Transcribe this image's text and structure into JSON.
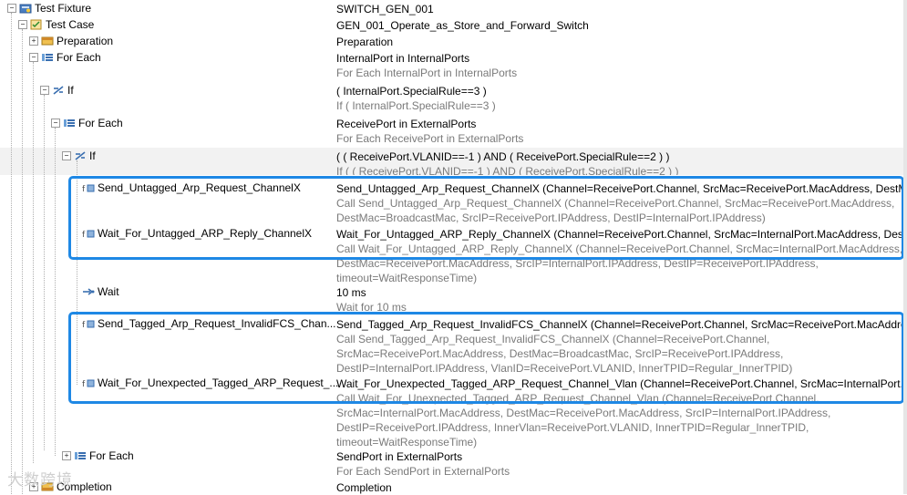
{
  "rows": [
    {
      "label": "Test Fixture",
      "icon": "test-fixture-icon",
      "expander": "−",
      "v1": "SWITCH_GEN_001",
      "v2": []
    },
    {
      "label": "Test Case",
      "icon": "test-case-icon",
      "expander": "−",
      "v1": "GEN_001_Operate_as_Store_and_Forward_Switch",
      "v2": []
    },
    {
      "label": "Preparation",
      "icon": "preparation-icon",
      "expander": "+",
      "v1": "Preparation",
      "v2": []
    },
    {
      "label": "For Each",
      "icon": "foreach-icon",
      "expander": "−",
      "v1": "InternalPort in InternalPorts",
      "v2": [
        "For Each InternalPort in InternalPorts"
      ]
    },
    {
      "label": "If",
      "icon": "if-icon",
      "expander": "−",
      "v1": "( InternalPort.SpecialRule==3 )",
      "v2": [
        "If ( InternalPort.SpecialRule==3 )"
      ]
    },
    {
      "label": "For Each",
      "icon": "foreach-icon",
      "expander": "−",
      "v1": "ReceivePort in ExternalPorts",
      "v2": [
        "For Each ReceivePort in ExternalPorts"
      ]
    },
    {
      "label": "If",
      "icon": "if-icon",
      "expander": "−",
      "v1": "( ( ReceivePort.VLANID==-1 ) AND ( ReceivePort.SpecialRule==2 ) )",
      "v2": [
        "If ( ( ReceivePort.VLANID==-1 ) AND ( ReceivePort.SpecialRule==2 ) )"
      ]
    },
    {
      "label": "Send_Untagged_Arp_Request_ChannelX",
      "icon": "call-icon",
      "expander": "",
      "v1": "Send_Untagged_Arp_Request_ChannelX (Channel=ReceivePort.Channel, SrcMac=ReceivePort.MacAddress, DestMac...",
      "v2": [
        "Call Send_Untagged_Arp_Request_ChannelX (Channel=ReceivePort.Channel, SrcMac=ReceivePort.MacAddress,",
        "DestMac=BroadcastMac, SrcIP=ReceivePort.IPAddress, DestIP=InternalPort.IPAddress)"
      ]
    },
    {
      "label": "Wait_For_Untagged_ARP_Reply_ChannelX",
      "icon": "call-icon",
      "expander": "",
      "v1": "Wait_For_Untagged_ARP_Reply_ChannelX (Channel=ReceivePort.Channel, SrcMac=InternalPort.MacAddress, DestM...",
      "v2": [
        "Call Wait_For_Untagged_ARP_Reply_ChannelX (Channel=ReceivePort.Channel, SrcMac=InternalPort.MacAddress,",
        "DestMac=ReceivePort.MacAddress, SrcIP=InternalPort.IPAddress, DestIP=ReceivePort.IPAddress,",
        "timeout=WaitResponseTime)"
      ]
    },
    {
      "label": "Wait",
      "icon": "wait-icon",
      "expander": "",
      "v1": "10 ms",
      "v2": [
        "Wait for 10 ms"
      ]
    },
    {
      "label": "Send_Tagged_Arp_Request_InvalidFCS_Chan...",
      "icon": "call-icon",
      "expander": "",
      "v1": "Send_Tagged_Arp_Request_InvalidFCS_ChannelX (Channel=ReceivePort.Channel, SrcMac=ReceivePort.MacAddress,...",
      "v2": [
        "Call Send_Tagged_Arp_Request_InvalidFCS_ChannelX (Channel=ReceivePort.Channel,",
        "SrcMac=ReceivePort.MacAddress, DestMac=BroadcastMac, SrcIP=ReceivePort.IPAddress,",
        "DestIP=InternalPort.IPAddress, VlanID=ReceivePort.VLANID, InnerTPID=Regular_InnerTPID)"
      ]
    },
    {
      "label": "Wait_For_Unexpected_Tagged_ARP_Request_...",
      "icon": "call-icon",
      "expander": "",
      "v1": "Wait_For_Unexpected_Tagged_ARP_Request_Channel_Vlan (Channel=ReceivePort.Channel, SrcMac=InternalPort.M...",
      "v2": [
        "Call Wait_For_Unexpected_Tagged_ARP_Request_Channel_Vlan (Channel=ReceivePort.Channel,",
        "SrcMac=InternalPort.MacAddress, DestMac=ReceivePort.MacAddress, SrcIP=InternalPort.IPAddress,",
        "DestIP=ReceivePort.IPAddress, InnerVlan=ReceivePort.VLANID, InnerTPID=Regular_InnerTPID,",
        "timeout=WaitResponseTime)"
      ]
    },
    {
      "label": "For Each",
      "icon": "foreach-icon",
      "expander": "+",
      "v1": "SendPort in ExternalPorts",
      "v2": [
        "For Each SendPort in ExternalPorts"
      ]
    },
    {
      "label": "Completion",
      "icon": "completion-icon",
      "expander": "+",
      "v1": "Completion",
      "v2": []
    }
  ],
  "watermark": "大数跨境",
  "colors": {
    "highlight": "#1e88e5",
    "secondary_text": "#7a7a7a",
    "alt_row": "#f2f2f2"
  }
}
